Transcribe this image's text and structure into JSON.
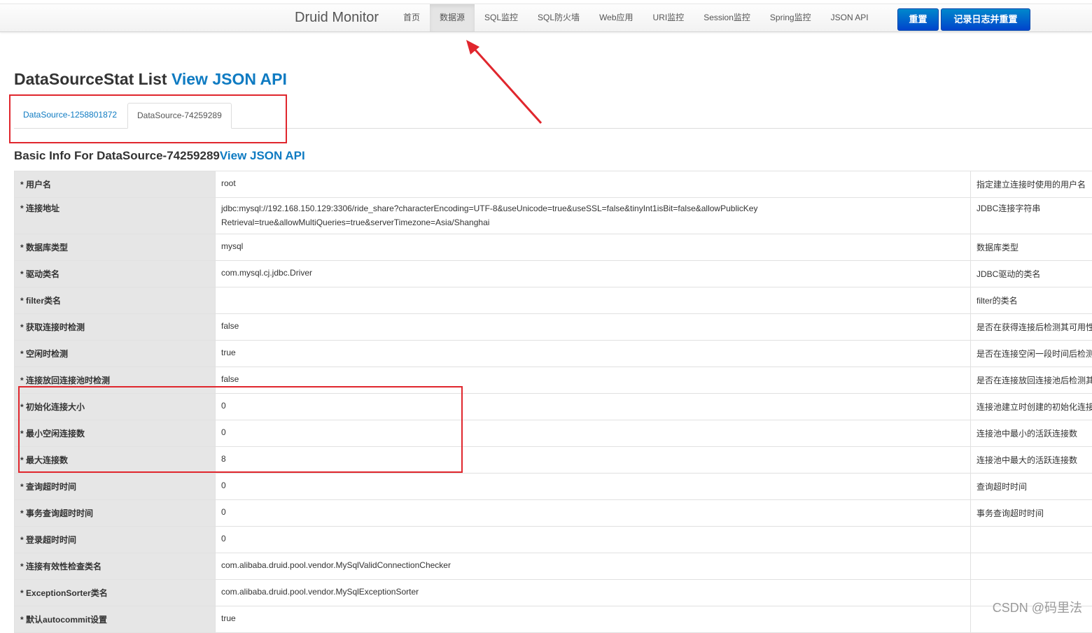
{
  "navbar": {
    "brand": "Druid Monitor",
    "items": [
      "首页",
      "数据源",
      "SQL监控",
      "SQL防火墙",
      "Web应用",
      "URI监控",
      "Session监控",
      "Spring监控",
      "JSON API"
    ],
    "active_index": 1,
    "reset_label": "重置",
    "log_reset_label": "记录日志并重置"
  },
  "page": {
    "title": "DataSourceStat List ",
    "title_link": "View JSON API",
    "tabs": [
      "DataSource-1258801872",
      "DataSource-74259289"
    ],
    "active_tab": 1,
    "basic_info_title": "Basic Info For DataSource-74259289",
    "basic_info_link": "View JSON API"
  },
  "rows": [
    {
      "key": "用户名",
      "value": "root",
      "desc": "指定建立连接时使用的用户名"
    },
    {
      "key": "连接地址",
      "value": "jdbc:mysql://192.168.150.129:3306/ride_share?characterEncoding=UTF-8&useUnicode=true&useSSL=false&tinyInt1isBit=false&allowPublicKeyRetrieval=true&allowMultiQueries=true&serverTimezone=Asia/Shanghai",
      "desc": "JDBC连接字符串"
    },
    {
      "key": "数据库类型",
      "value": "mysql",
      "desc": "数据库类型"
    },
    {
      "key": "驱动类名",
      "value": "com.mysql.cj.jdbc.Driver",
      "desc": "JDBC驱动的类名"
    },
    {
      "key": "filter类名",
      "value": "",
      "desc": "filter的类名"
    },
    {
      "key": "获取连接时检测",
      "value": "false",
      "desc": "是否在获得连接后检测其可用性"
    },
    {
      "key": "空闲时检测",
      "value": "true",
      "desc": "是否在连接空闲一段时间后检测"
    },
    {
      "key": "连接放回连接池时检测",
      "value": "false",
      "desc": "是否在连接放回连接池后检测其"
    },
    {
      "key": "初始化连接大小",
      "value": "0",
      "desc": "连接池建立时创建的初始化连接"
    },
    {
      "key": "最小空闲连接数",
      "value": "0",
      "desc": "连接池中最小的活跃连接数"
    },
    {
      "key": "最大连接数",
      "value": "8",
      "desc": "连接池中最大的活跃连接数"
    },
    {
      "key": "查询超时时间",
      "value": "0",
      "desc": "查询超时时间"
    },
    {
      "key": "事务查询超时时间",
      "value": "0",
      "desc": "事务查询超时时间"
    },
    {
      "key": "登录超时时间",
      "value": "0",
      "desc": ""
    },
    {
      "key": "连接有效性检查类名",
      "value": "com.alibaba.druid.pool.vendor.MySqlValidConnectionChecker",
      "desc": ""
    },
    {
      "key": "ExceptionSorter类名",
      "value": "com.alibaba.druid.pool.vendor.MySqlExceptionSorter",
      "desc": ""
    },
    {
      "key": "默认autocommit设置",
      "value": "true",
      "desc": ""
    }
  ],
  "watermark": "CSDN @码里法",
  "annotation_color": "#e0262d"
}
